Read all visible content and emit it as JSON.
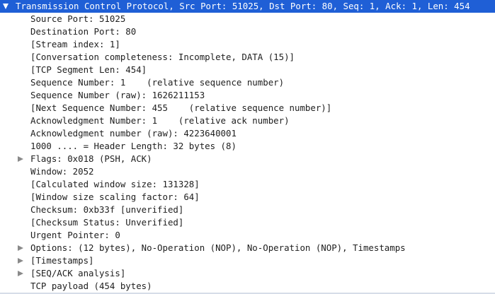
{
  "header": {
    "label": "Transmission Control Protocol, Src Port: 51025, Dst Port: 80, Seq: 1, Ack: 1, Len: 454",
    "expanded": true
  },
  "fields": [
    {
      "text": "Source Port: 51025",
      "expandable": false
    },
    {
      "text": "Destination Port: 80",
      "expandable": false
    },
    {
      "text": "[Stream index: 1]",
      "expandable": false
    },
    {
      "text": "[Conversation completeness: Incomplete, DATA (15)]",
      "expandable": false
    },
    {
      "text": "[TCP Segment Len: 454]",
      "expandable": false
    },
    {
      "text": "Sequence Number: 1    (relative sequence number)",
      "expandable": false
    },
    {
      "text": "Sequence Number (raw): 1626211153",
      "expandable": false
    },
    {
      "text": "[Next Sequence Number: 455    (relative sequence number)]",
      "expandable": false
    },
    {
      "text": "Acknowledgment Number: 1    (relative ack number)",
      "expandable": false
    },
    {
      "text": "Acknowledgment number (raw): 4223640001",
      "expandable": false
    },
    {
      "text": "1000 .... = Header Length: 32 bytes (8)",
      "expandable": false
    },
    {
      "text": "Flags: 0x018 (PSH, ACK)",
      "expandable": true
    },
    {
      "text": "Window: 2052",
      "expandable": false
    },
    {
      "text": "[Calculated window size: 131328]",
      "expandable": false
    },
    {
      "text": "[Window size scaling factor: 64]",
      "expandable": false
    },
    {
      "text": "Checksum: 0xb33f [unverified]",
      "expandable": false
    },
    {
      "text": "[Checksum Status: Unverified]",
      "expandable": false
    },
    {
      "text": "Urgent Pointer: 0",
      "expandable": false
    },
    {
      "text": "Options: (12 bytes), No-Operation (NOP), No-Operation (NOP), Timestamps",
      "expandable": true
    },
    {
      "text": "[Timestamps]",
      "expandable": true
    },
    {
      "text": "[SEQ/ACK analysis]",
      "expandable": true
    },
    {
      "text": "TCP payload (454 bytes)",
      "expandable": false
    }
  ],
  "colors": {
    "selection": "#1f5fd6",
    "text": "#1e1e1e",
    "expander": "#8a8a8a"
  }
}
